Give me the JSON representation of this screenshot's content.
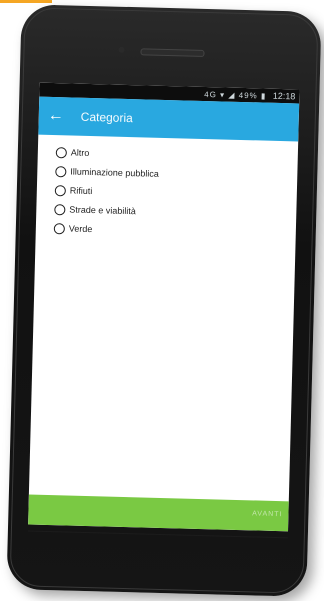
{
  "status_bar": {
    "icons": "4G ▾ ◢ 49% ▮",
    "time": "12:18"
  },
  "app_bar": {
    "back_icon": "←",
    "title": "Categoria"
  },
  "categories": [
    {
      "label": "Altro"
    },
    {
      "label": "Illuminazione pubblica"
    },
    {
      "label": "Rifiuti"
    },
    {
      "label": "Strade e viabilità"
    },
    {
      "label": "Verde"
    }
  ],
  "bottom_bar": {
    "action_label": "AVANTI"
  },
  "colors": {
    "app_bar": "#29a8e0",
    "bottom_bar": "#7ac943",
    "accent_line": "#f5a623"
  }
}
